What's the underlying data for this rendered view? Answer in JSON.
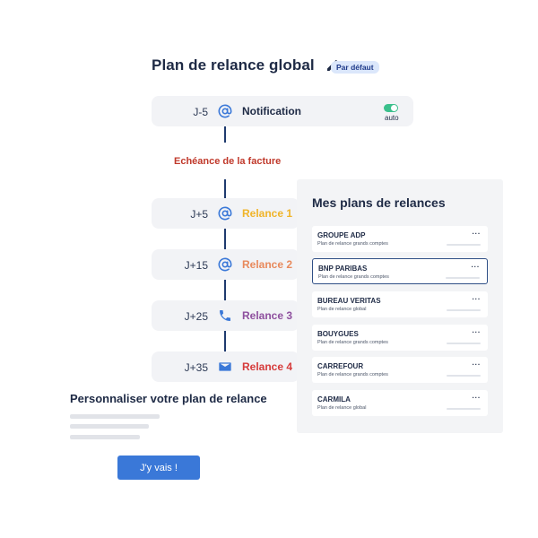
{
  "header": {
    "title": "Plan de relance global",
    "badge": "Par défaut"
  },
  "timeline": {
    "steps": [
      {
        "day": "J-5",
        "icon": "at-sign-icon",
        "label": "Notification",
        "color": "#1e2a45",
        "toggle": {
          "state": "on",
          "label": "auto"
        }
      },
      {
        "day": "J+5",
        "icon": "at-sign-icon",
        "label": "Relance 1",
        "color": "#f0b429"
      },
      {
        "day": "J+15",
        "icon": "at-sign-icon",
        "label": "Relance 2",
        "color": "#e8895c"
      },
      {
        "day": "J+25",
        "icon": "phone-icon",
        "label": "Relance 3",
        "color": "#8e4f9e"
      },
      {
        "day": "J+35",
        "icon": "envelope-icon",
        "label": "Relance 4",
        "color": "#d63b3b"
      }
    ],
    "due_label": "Echéance de la facture"
  },
  "plans_panel": {
    "title": "Mes plans de relances",
    "items": [
      {
        "name": "GROUPE ADP",
        "subtitle": "Plan de relance grands comptes",
        "selected": false
      },
      {
        "name": "BNP PARIBAS",
        "subtitle": "Plan de relance grands comptes",
        "selected": true
      },
      {
        "name": "BUREAU VERITAS",
        "subtitle": "Plan de relance global",
        "selected": false
      },
      {
        "name": "BOUYGUES",
        "subtitle": "Plan de relance grands comptes",
        "selected": false
      },
      {
        "name": "CARREFOUR",
        "subtitle": "Plan de relance grands comptes",
        "selected": false
      },
      {
        "name": "CARMILA",
        "subtitle": "Plan de relance global",
        "selected": false
      }
    ],
    "menu_label": "···"
  },
  "customize": {
    "title": "Personnaliser votre plan de relance",
    "button_label": "J'y vais !"
  },
  "colors": {
    "accent": "#3a78d8",
    "timeline_line": "#1e3a6e",
    "due_label": "#c0392b",
    "toggle_on": "#3bc08c"
  }
}
